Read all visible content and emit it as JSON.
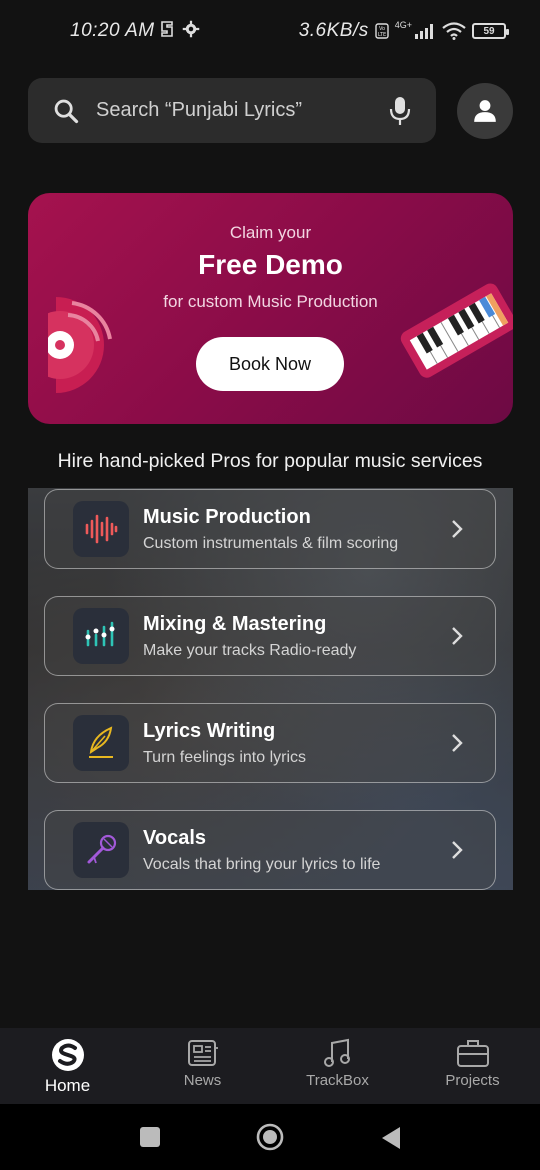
{
  "status_bar": {
    "time": "10:20 AM",
    "network_speed": "3.6KB/s",
    "network_type": "4G+",
    "battery": "59"
  },
  "search": {
    "placeholder": "Search “Punjabi Lyrics”"
  },
  "banner": {
    "claim": "Claim your",
    "title": "Free Demo",
    "subtitle": "for custom Music Production",
    "button_label": "Book Now",
    "gradient_colors": [
      "#a5124e",
      "#6d0a44"
    ]
  },
  "section": {
    "heading": "Hire hand-picked Pros for popular music services"
  },
  "services": [
    {
      "title": "Music Production",
      "description": "Custom instrumentals & film scoring",
      "icon": "waveform-icon",
      "icon_color": "#ef5a5a"
    },
    {
      "title": "Mixing & Mastering",
      "description": "Make your tracks Radio-ready",
      "icon": "equalizer-icon",
      "icon_color": "#2ec4b6"
    },
    {
      "title": "Lyrics Writing",
      "description": "Turn feelings into lyrics",
      "icon": "quill-icon",
      "icon_color": "#e8b820"
    },
    {
      "title": "Vocals",
      "description": "Vocals that bring your lyrics to life",
      "icon": "microphone-icon",
      "icon_color": "#a259d9"
    }
  ],
  "bottom_nav": [
    {
      "label": "Home",
      "icon": "home-logo-icon",
      "active": true
    },
    {
      "label": "News",
      "icon": "news-icon",
      "active": false
    },
    {
      "label": "TrackBox",
      "icon": "music-note-icon",
      "active": false
    },
    {
      "label": "Projects",
      "icon": "briefcase-icon",
      "active": false
    }
  ]
}
